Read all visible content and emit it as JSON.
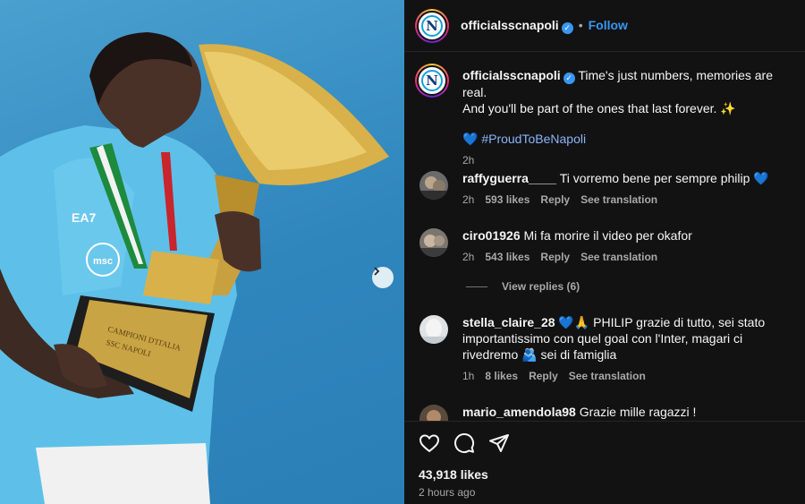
{
  "post": {
    "username": "officialsscnapoli",
    "follow_label": "Follow",
    "separator": "•",
    "logo_letter": "N",
    "caption_line1": "Time's just numbers, memories are real.",
    "caption_line2": "And you'll be part of the ones that last forever.",
    "caption_emoji": "✨",
    "hashtag_emoji": "💙",
    "hashtag": "#ProudToBeNapoli",
    "caption_age": "2h",
    "likes": "43,918 likes",
    "posted_ago": "2 hours ago",
    "photo_texts": {
      "sponsor": "EA7",
      "trophy_text1": "CAMPIONI D'ITALIA",
      "trophy_text2": "SSC NAPOLI"
    }
  },
  "comments": [
    {
      "user": "raffyguerra____",
      "text": "Ti vorremo bene per sempre philip 💙",
      "age": "2h",
      "likes": "593 likes",
      "reply": "Reply",
      "translate": "See translation"
    },
    {
      "user": "ciro01926",
      "text": "Mi fa morire il video per okafor",
      "age": "2h",
      "likes": "543 likes",
      "reply": "Reply",
      "translate": "See translation",
      "view_replies": "View replies (6)"
    },
    {
      "user": "stella_claire_28",
      "text": "💙🙏 PHILIP grazie di tutto, sei stato importantissimo con quel goal con l'Inter, magari ci rivedremo 🫂 sei di famiglia",
      "age": "1h",
      "likes": "8 likes",
      "reply": "Reply",
      "translate": "See translation"
    },
    {
      "user": "mario_amendola98",
      "text": "Grazie mille ragazzi !"
    }
  ],
  "colors": {
    "accent": "#3797f0",
    "panel_bg": "#121212",
    "photo_bg": "#3a92c7",
    "secondary_text": "#a8a8a8"
  },
  "icons": [
    "chevron-right-icon",
    "verified-badge-icon",
    "heart-icon",
    "comment-icon",
    "share-icon"
  ]
}
